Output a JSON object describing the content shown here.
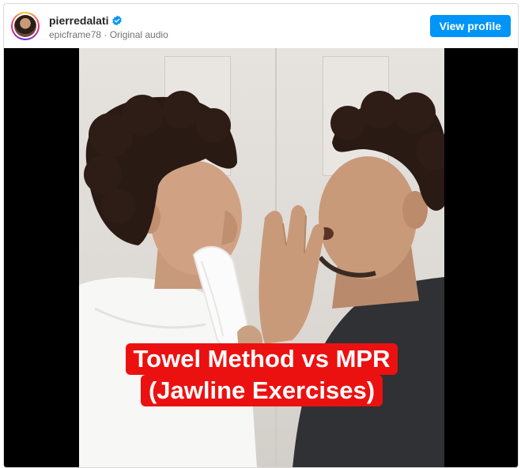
{
  "post": {
    "username": "pierredalati",
    "verified": true,
    "subline": "epicframe78 · Original audio",
    "view_profile_label": "View profile"
  },
  "media": {
    "caption_line1": "Towel Method vs MPR",
    "caption_line2": "(Jawline Exercises)"
  },
  "colors": {
    "button_blue": "#0095f6",
    "caption_red": "#ec1111",
    "letterbox": "#000000"
  },
  "icons": {
    "verified": "verified-badge-icon"
  }
}
